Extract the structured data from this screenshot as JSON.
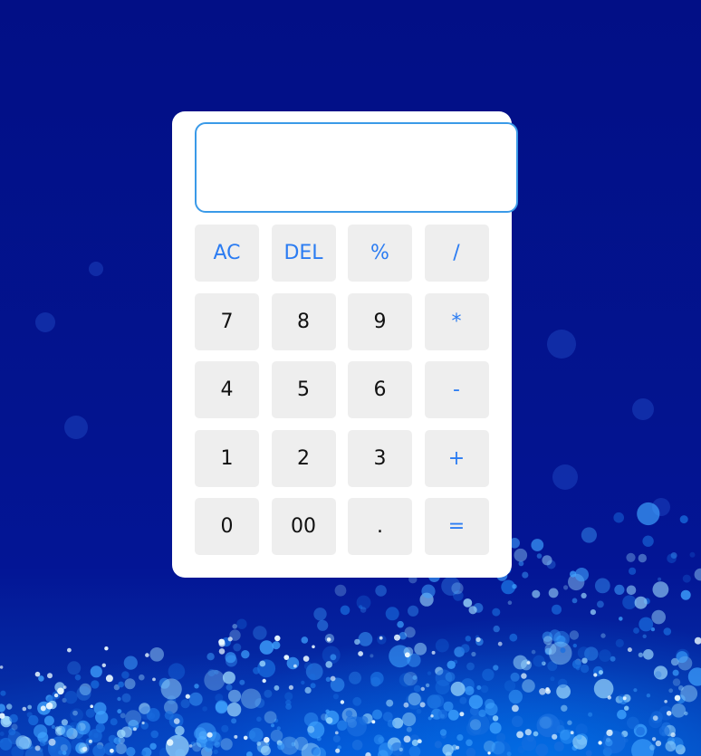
{
  "calculator": {
    "display_value": "",
    "keys": [
      {
        "label": "AC",
        "type": "op",
        "name": "clear-all-button"
      },
      {
        "label": "DEL",
        "type": "op",
        "name": "delete-button"
      },
      {
        "label": "%",
        "type": "op",
        "name": "percent-button"
      },
      {
        "label": "/",
        "type": "op",
        "name": "divide-button"
      },
      {
        "label": "7",
        "type": "num",
        "name": "digit-7-button"
      },
      {
        "label": "8",
        "type": "num",
        "name": "digit-8-button"
      },
      {
        "label": "9",
        "type": "num",
        "name": "digit-9-button"
      },
      {
        "label": "*",
        "type": "op",
        "name": "multiply-button"
      },
      {
        "label": "4",
        "type": "num",
        "name": "digit-4-button"
      },
      {
        "label": "5",
        "type": "num",
        "name": "digit-5-button"
      },
      {
        "label": "6",
        "type": "num",
        "name": "digit-6-button"
      },
      {
        "label": "-",
        "type": "op",
        "name": "subtract-button"
      },
      {
        "label": "1",
        "type": "num",
        "name": "digit-1-button"
      },
      {
        "label": "2",
        "type": "num",
        "name": "digit-2-button"
      },
      {
        "label": "3",
        "type": "num",
        "name": "digit-3-button"
      },
      {
        "label": "+",
        "type": "op",
        "name": "add-button"
      },
      {
        "label": "0",
        "type": "num",
        "name": "digit-0-button"
      },
      {
        "label": "00",
        "type": "num",
        "name": "double-zero-button"
      },
      {
        "label": ".",
        "type": "num",
        "name": "decimal-point-button"
      },
      {
        "label": "=",
        "type": "op",
        "name": "equals-button"
      }
    ]
  },
  "colors": {
    "operator_text": "#2b7cf2",
    "number_text": "#111111",
    "key_background": "#eeeeee",
    "display_border": "#3a9ae8",
    "page_background": "#03148f"
  }
}
